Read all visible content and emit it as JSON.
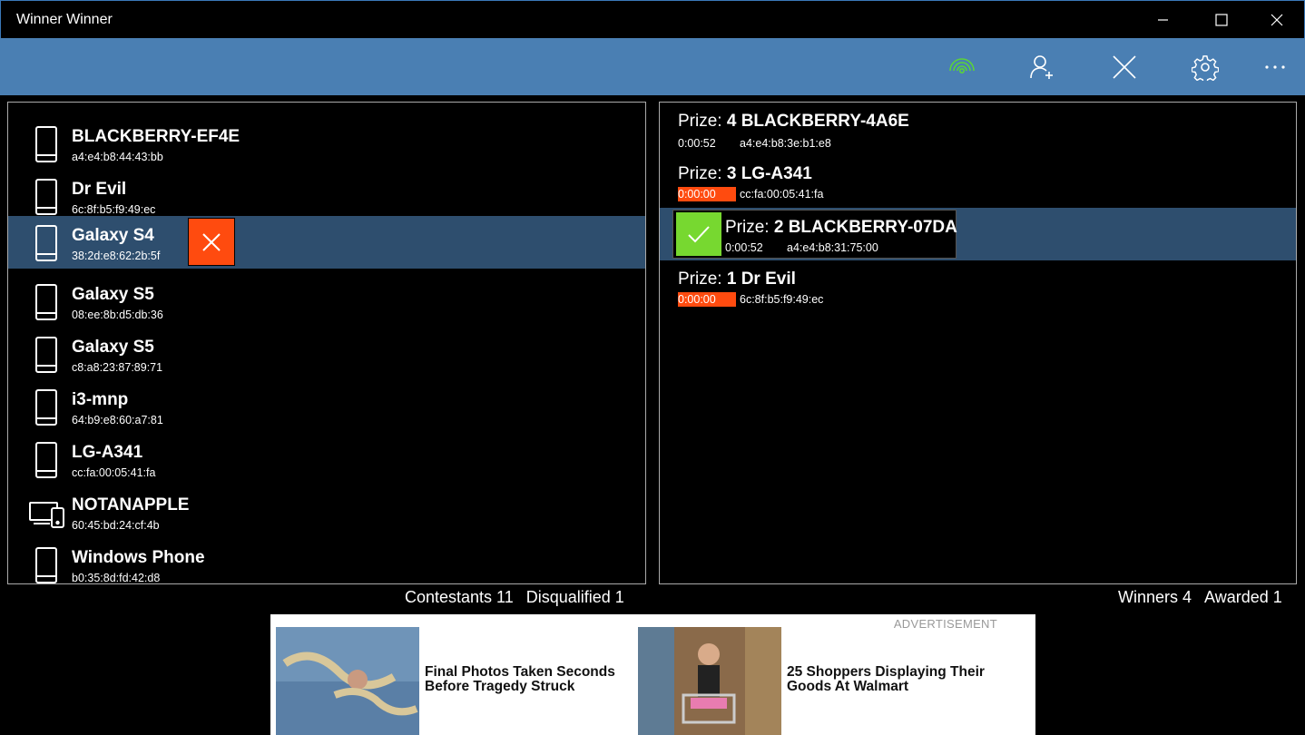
{
  "window": {
    "title": "Winner Winner",
    "controls": [
      "minimize",
      "maximize",
      "close"
    ]
  },
  "toolbar": {
    "buttons": [
      {
        "icon": "wifi-broadcast-icon",
        "color": "#5bd33a"
      },
      {
        "icon": "add-contestant-icon"
      },
      {
        "icon": "clear-icon"
      },
      {
        "icon": "gear-icon"
      },
      {
        "icon": "more-icon"
      }
    ]
  },
  "contestants": [
    {
      "name": "BLACKBERRY-EF4E",
      "mac": "a4:e4:b8:44:43:bb",
      "device": "phone"
    },
    {
      "name": "Dr Evil",
      "mac": "6c:8f:b5:f9:49:ec",
      "device": "phone"
    },
    {
      "name": "Galaxy S4",
      "mac": "38:2d:e8:62:2b:5f",
      "device": "phone",
      "selected": true
    },
    {
      "name": "Galaxy S5",
      "mac": "08:ee:8b:d5:db:36",
      "device": "phone"
    },
    {
      "name": "Galaxy S5",
      "mac": "c8:a8:23:87:89:71",
      "device": "phone"
    },
    {
      "name": "i3-mnp",
      "mac": "64:b9:e8:60:a7:81",
      "device": "phone"
    },
    {
      "name": "LG-A341",
      "mac": "cc:fa:00:05:41:fa",
      "device": "phone"
    },
    {
      "name": "NOTANAPPLE",
      "mac": "60:45:bd:24:cf:4b",
      "device": "multi-device"
    },
    {
      "name": "Windows Phone",
      "mac": "b0:35:8d:fd:42:d8",
      "device": "phone"
    }
  ],
  "winners": [
    {
      "prize_label": "Prize:",
      "prize": "4 BLACKBERRY-4A6E",
      "time": "0:00:52",
      "mac": "a4:e4:b8:3e:b1:e8",
      "expired": false
    },
    {
      "prize_label": "Prize:",
      "prize": "3 LG-A341",
      "time": "0:00:00",
      "mac": "cc:fa:00:05:41:fa",
      "expired": true
    },
    {
      "prize_label": "Prize:",
      "prize": "2 BLACKBERRY-07DA",
      "time": "0:00:52",
      "mac": "a4:e4:b8:31:75:00",
      "awarded": true
    },
    {
      "prize_label": "Prize:",
      "prize": "1 Dr Evil",
      "time": "0:00:00",
      "mac": "6c:8f:b5:f9:49:ec",
      "expired": true
    }
  ],
  "status": {
    "contestants": "Contestants 11",
    "disqualified": "Disqualified 1",
    "winners": "Winners 4",
    "awarded": "Awarded 1"
  },
  "ad": {
    "label": "ADVERTISEMENT",
    "items": [
      {
        "text": "Final Photos Taken Seconds Before Tragedy Struck"
      },
      {
        "text": "25 Shoppers Displaying Their Goods At Walmart"
      }
    ]
  },
  "colors": {
    "accent": "#4a7fb3",
    "selected_row": "#2e4e6e",
    "danger": "#ff4b0f",
    "success": "#77d830",
    "broadcast": "#5bd33a"
  }
}
